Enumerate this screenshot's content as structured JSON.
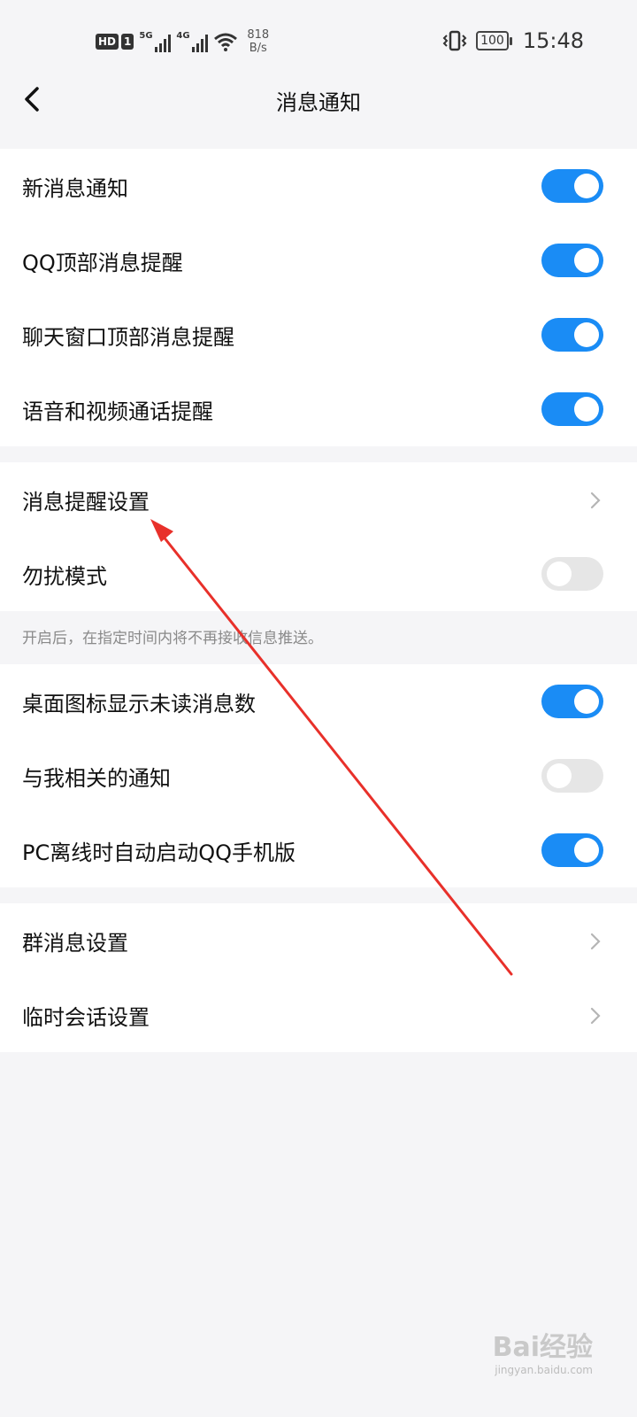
{
  "status_bar": {
    "hd_badges": [
      "HD",
      "1"
    ],
    "net1": "5G",
    "net2": "4G",
    "speed_value": "818",
    "speed_unit": "B/s",
    "battery": "100",
    "time": "15:48"
  },
  "header": {
    "title": "消息通知"
  },
  "group1": [
    {
      "label": "新消息通知",
      "on": true
    },
    {
      "label": "QQ顶部消息提醒",
      "on": true
    },
    {
      "label": "聊天窗口顶部消息提醒",
      "on": true
    },
    {
      "label": "语音和视频通话提醒",
      "on": true
    }
  ],
  "group2": [
    {
      "label": "消息提醒设置"
    },
    {
      "label": "勿扰模式",
      "on": false
    }
  ],
  "dnd_note": "开启后，在指定时间内将不再接收信息推送。",
  "group3": [
    {
      "label": "桌面图标显示未读消息数",
      "on": true
    },
    {
      "label": "与我相关的通知",
      "on": false
    },
    {
      "label": "PC离线时自动启动QQ手机版",
      "on": true
    }
  ],
  "group4": [
    {
      "label": "群消息设置"
    },
    {
      "label": "临时会话设置"
    }
  ],
  "watermark": {
    "brand": "Bai经验",
    "sub": "jingyan.baidu.com"
  },
  "colors": {
    "accent": "#1a8cf5",
    "toggle_off": "#e6e6e6",
    "annotation_arrow": "#e8302a"
  }
}
